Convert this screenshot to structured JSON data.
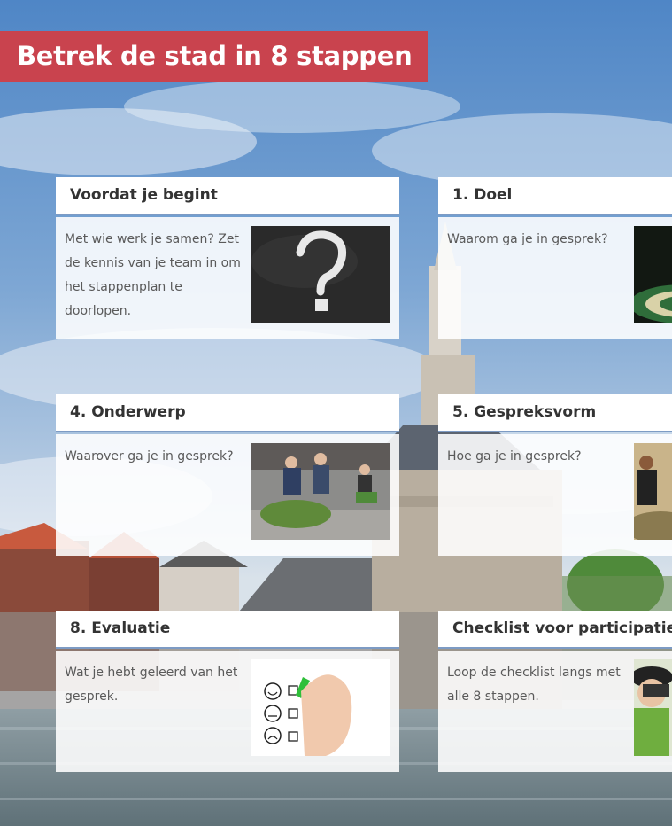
{
  "page": {
    "title": "Betrek de stad in 8 stappen"
  },
  "colors": {
    "title_bg": "#c9434e",
    "header_border": "#7d9bc4",
    "text": "#5a5a5a",
    "heading": "#333333"
  },
  "cards": [
    {
      "title": "Voordat je begint",
      "description": "Met wie werk je samen? Zet de kennis van je team in om het stappenplan te doorlopen.",
      "image": "chalkboard-question-mark"
    },
    {
      "title": "1. Doel",
      "description": "Waarom ga je in gesprek?",
      "image": "dartboard"
    },
    {
      "title": "4. Onderwerp",
      "description": "Waarover ga je in gesprek?",
      "image": "people-planting"
    },
    {
      "title": "5. Gespreksvorm",
      "description": "Hoe ga je in gesprek?",
      "image": "group-meeting"
    },
    {
      "title": "8. Evaluatie",
      "description": "Wat je hebt geleerd van het gesprek.",
      "image": "feedback-checklist"
    },
    {
      "title": "Checklist voor participatie",
      "description": "Loop de checklist langs met alle 8 stappen.",
      "image": "child-binoculars"
    }
  ]
}
